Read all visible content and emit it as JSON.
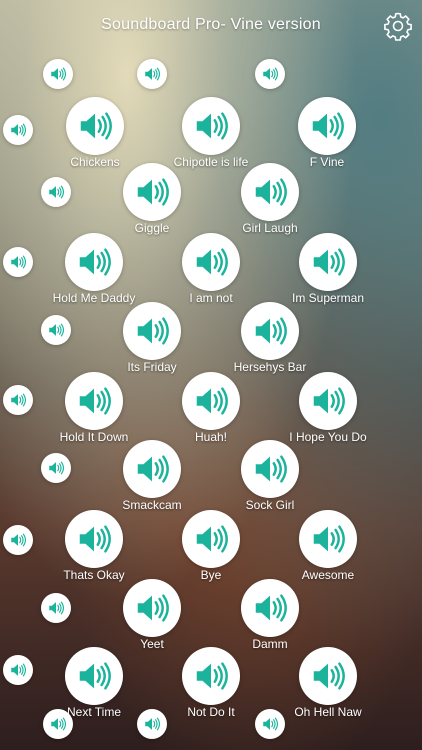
{
  "header": {
    "title": "Soundboard Pro- Vine version",
    "settings_icon": "gear-icon"
  },
  "theme": {
    "accent": "#1bb39b",
    "button_bg": "#ffffff"
  },
  "sounds": [
    {
      "label": "Chickens",
      "icon": "speaker-icon"
    },
    {
      "label": "Chipotle is life",
      "icon": "speaker-icon"
    },
    {
      "label": "F Vine",
      "icon": "speaker-icon"
    },
    {
      "label": "Giggle",
      "icon": "speaker-icon"
    },
    {
      "label": "Girl Laugh",
      "icon": "speaker-icon"
    },
    {
      "label": "Hold Me Daddy",
      "icon": "speaker-icon"
    },
    {
      "label": "I am not",
      "icon": "speaker-icon"
    },
    {
      "label": "Im Superman",
      "icon": "speaker-icon"
    },
    {
      "label": "Its Friday",
      "icon": "speaker-icon"
    },
    {
      "label": "Hersehys Bar",
      "icon": "speaker-icon"
    },
    {
      "label": "Hold It Down",
      "icon": "speaker-icon"
    },
    {
      "label": "Huah!",
      "icon": "speaker-icon"
    },
    {
      "label": "I Hope You Do",
      "icon": "speaker-icon"
    },
    {
      "label": "Smackcam",
      "icon": "speaker-icon"
    },
    {
      "label": "Sock Girl",
      "icon": "speaker-icon"
    },
    {
      "label": "Thats Okay",
      "icon": "speaker-icon"
    },
    {
      "label": "Bye",
      "icon": "speaker-icon"
    },
    {
      "label": "Awesome",
      "icon": "speaker-icon"
    },
    {
      "label": "Yeet",
      "icon": "speaker-icon"
    },
    {
      "label": "Damm",
      "icon": "speaker-icon"
    },
    {
      "label": "Next Time",
      "icon": "speaker-icon"
    },
    {
      "label": "Not Do It",
      "icon": "speaker-icon"
    },
    {
      "label": "Oh Hell Naw",
      "icon": "speaker-icon"
    }
  ]
}
